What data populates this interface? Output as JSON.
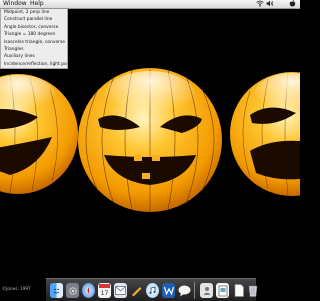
{
  "menubar": {
    "items": [
      "Window",
      "Help"
    ],
    "status_icons": [
      "wifi-icon",
      "volume-icon",
      "apple-menu-icon"
    ]
  },
  "dropdown": {
    "items": [
      "Midpoint, 2 perp line",
      "Construct parallel line",
      "Angle bisector, converse",
      "Triangle = 180 degrees",
      "Isosceles triangle, converse",
      "Triangles",
      "Auxiliary lines",
      "Incidence/reflection, light pool"
    ]
  },
  "footer": {
    "text": "©Jones, 1997"
  },
  "wallpaper": {
    "subject": "three jack-o-lantern orbs",
    "accent": "#f5a000"
  },
  "dock": {
    "icons": [
      "finder-icon",
      "system-preferences-icon",
      "safari-icon",
      "ical-icon",
      "mail-icon",
      "pencil-icon",
      "itunes-icon",
      "word-icon",
      "ichat-icon",
      "address-book-icon",
      "preview-icon",
      "document-icon",
      "trash-icon"
    ]
  }
}
